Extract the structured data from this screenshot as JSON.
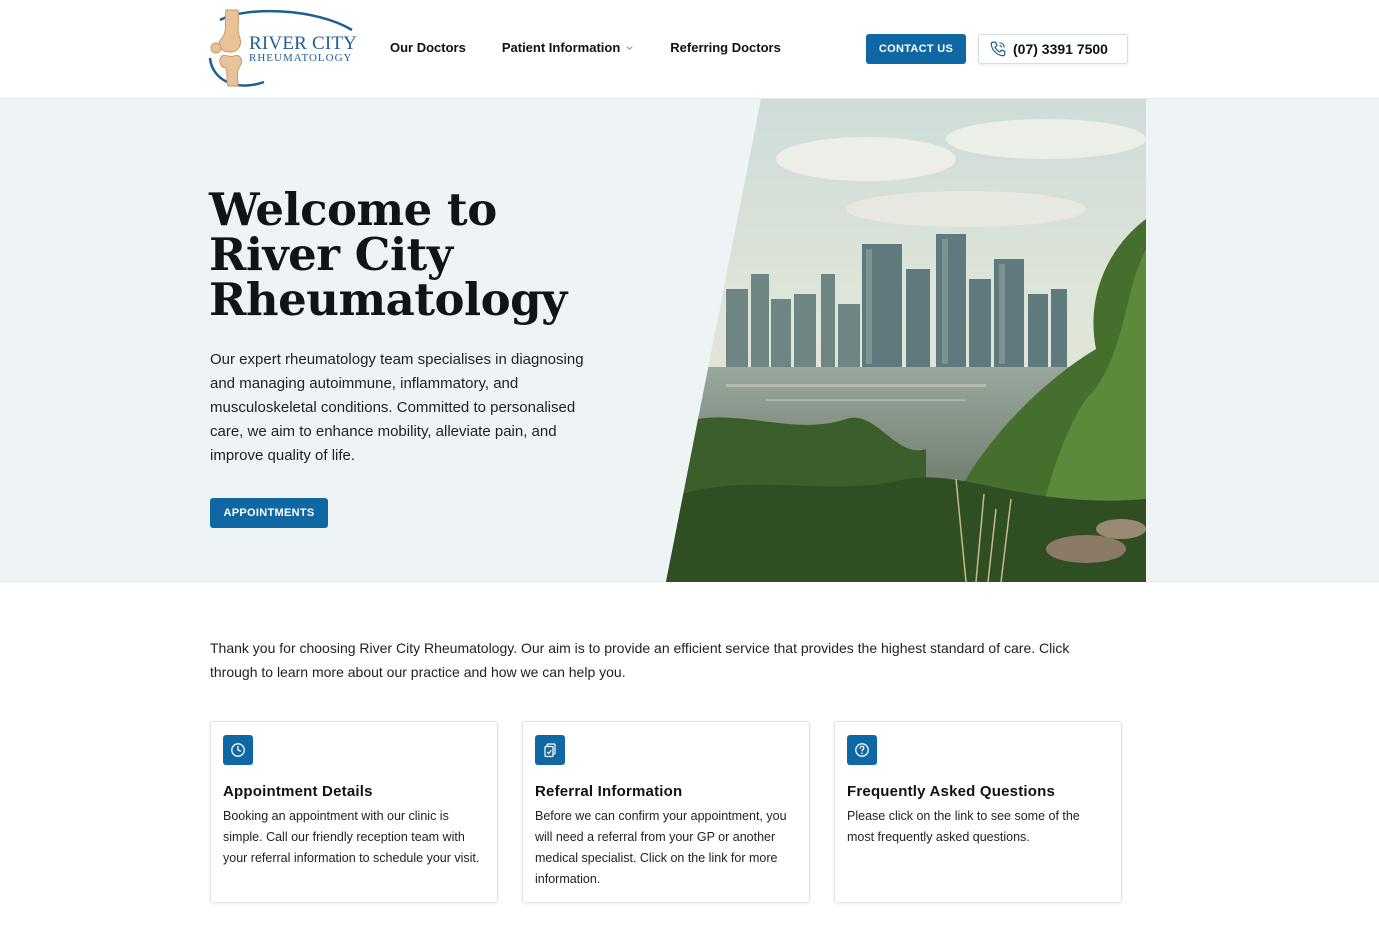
{
  "brand": {
    "line1": "RIVER CITY",
    "line2": "RHEUMATOLOGY",
    "logo_icon": "knee-joint-logo",
    "primary_color": "#0f67a3",
    "hero_bg_color": "#eef4f6"
  },
  "nav": {
    "items": [
      {
        "label": "Our Doctors"
      },
      {
        "label": "Patient Information",
        "has_dropdown": true
      },
      {
        "label": "Referring Doctors"
      }
    ]
  },
  "header": {
    "contact_label": "CONTACT US",
    "phone_icon": "phone-icon",
    "phone_label": "(07) 3391 7500"
  },
  "hero": {
    "title_lines": [
      "Welcome to",
      "River City",
      "Rheumatology"
    ],
    "text": "Our expert rheumatology team specialises in diagnosing and managing autoimmune, inflammatory, and musculoskeletal conditions. Committed to personalised care, we aim to enhance mobility, alleviate pain, and improve quality of life.",
    "cta_label": "APPOINTMENTS",
    "image": "brisbane-city-skyline-river-photo"
  },
  "intro": {
    "text": "Thank you for choosing River City Rheumatology. Our aim is to provide an efficient service that provides the highest standard of care. Click through to learn more about our practice and how we can help you."
  },
  "cards": [
    {
      "icon": "clock-icon",
      "title": "Appointment Details",
      "text": "Booking an appointment with our clinic is simple. Call our friendly reception team with your referral information to schedule your visit."
    },
    {
      "icon": "clipboard-copy-icon",
      "title": "Referral Information",
      "text": "Before we can confirm your appointment, you will need a referral from your GP or another medical specialist. Click on the link for more information."
    },
    {
      "icon": "question-circle-icon",
      "title": "Frequently Asked Questions",
      "text": "Please click on the link to see some of the most frequently asked questions."
    }
  ]
}
